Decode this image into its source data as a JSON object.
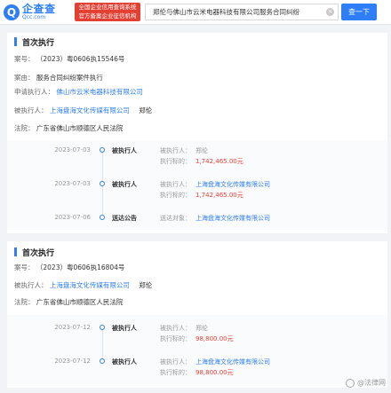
{
  "header": {
    "logo_mark": "Q",
    "logo_name": "企查查",
    "logo_domain": "Qcc.com",
    "badge_line1": "全国企业信用查询系统",
    "badge_line2": "官方备案企业征信机构",
    "search_value": "郑伦与佛山市云米电器科技有限公司服务合同纠纷",
    "search_button": "查一下"
  },
  "case1": {
    "title": "首次执行",
    "fields": [
      {
        "label": "案号：",
        "value": "（2023）粤0606执15546号"
      },
      {
        "label": "案由：",
        "value": "服务合同纠纷案件执行"
      },
      {
        "label": "申请执行人：",
        "value": "佛山市云米电器科技有限公司"
      },
      {
        "label": "被执行人：",
        "value": "上海盘海文化传媒有限公司",
        "value2": "郑伦"
      },
      {
        "label": "法院：",
        "value": "广东省佛山市顺德区人民法院"
      }
    ],
    "timeline": [
      {
        "date": "2023-07-03",
        "type": "被执行人",
        "k1": "被执行人：",
        "v1": "郑伦",
        "k2": "执行标的：",
        "v2": "1,742,465.00元"
      },
      {
        "date": "2023-07-03",
        "type": "被执行人",
        "k1": "被执行人：",
        "v1": "上海盘海文化传媒有限公司",
        "k2": "执行标的：",
        "v2": "1,742,465.00元"
      },
      {
        "date": "2023-07-06",
        "type": "送达公告",
        "k1": "送达对象：",
        "v1": "上海盘海文化传媒有限公司"
      }
    ]
  },
  "case2": {
    "title": "首次执行",
    "fields": [
      {
        "label": "案号：",
        "value": "（2023）粤0606执16804号"
      },
      {
        "label": "被执行人：",
        "value": "上海盘海文化传媒有限公司",
        "value2": "郑伦"
      },
      {
        "label": "法院：",
        "value": "广东省佛山市顺德区人民法院"
      }
    ],
    "timeline": [
      {
        "date": "2023-07-12",
        "type": "被执行人",
        "k1": "被执行人：",
        "v1": "郑伦",
        "k2": "执行标的：",
        "v2": "98,800.00元"
      },
      {
        "date": "2023-07-12",
        "type": "被执行人",
        "k1": "被执行人：",
        "v1": "上海盘海文化传媒有限公司",
        "k2": "执行标的：",
        "v2": "98,800.00元"
      }
    ]
  },
  "watermark": "@法律网",
  "colors": {
    "accent": "#2d7ef7",
    "money": "#e43f33"
  }
}
